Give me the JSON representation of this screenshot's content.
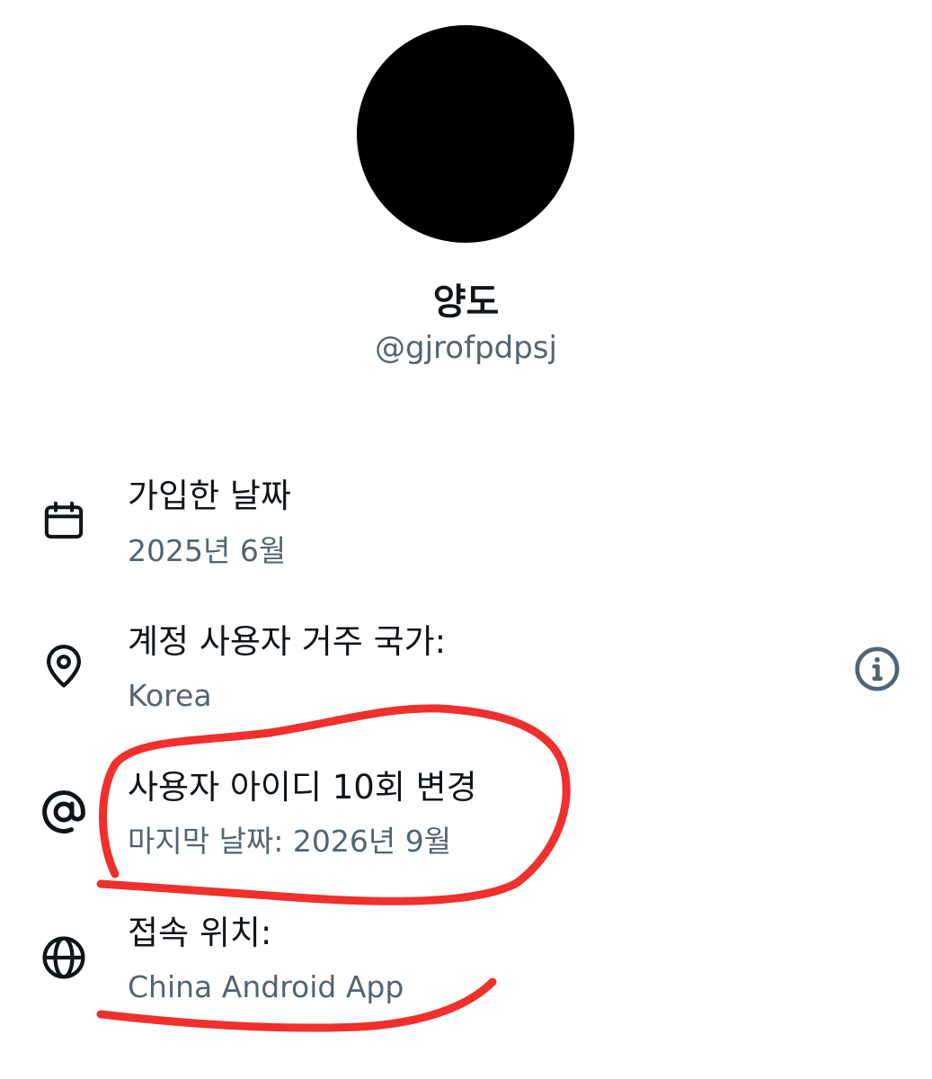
{
  "profile": {
    "display_name": "양도",
    "handle": "@gjrofpdpsj"
  },
  "rows": [
    {
      "icon": "calendar-icon",
      "title": "가입한 날짜",
      "subtitle": "2025년 6월"
    },
    {
      "icon": "location-pin-icon",
      "title": "계정 사용자 거주 국가:",
      "subtitle": "Korea"
    },
    {
      "icon": "at-sign-icon",
      "title": "사용자 아이디 10회 변경",
      "subtitle": "마지막 날짜: 2026년 9월"
    },
    {
      "icon": "globe-icon",
      "title": "접속 위치:",
      "subtitle": "China Android App"
    }
  ],
  "colors": {
    "primary_text": "#0f1419",
    "secondary_text": "#536471",
    "annotation": "#f0302c"
  }
}
